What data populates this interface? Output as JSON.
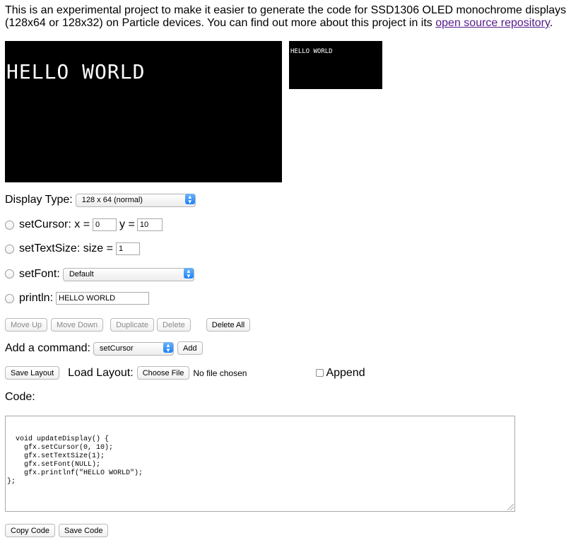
{
  "intro": {
    "text": "This is an experimental project to make it easier to generate the code for SSD1306 OLED monochrome displays (128x64 or 128x32) on Particle devices. You can find out more about this project in its ",
    "link_text": "open source repository",
    "suffix": "."
  },
  "preview": {
    "large_text": "HELLO WORLD",
    "small_text": "HELLO WORLD"
  },
  "display_type": {
    "label": "Display Type:",
    "selected": "128 x 64 (normal)"
  },
  "commands": [
    {
      "name": "setCursor",
      "label": "setCursor: x =",
      "x_value": "0",
      "y_label": "y =",
      "y_value": "10"
    },
    {
      "name": "setTextSize",
      "label": "setTextSize: size =",
      "value": "1"
    },
    {
      "name": "setFont",
      "label": "setFont:",
      "selected": "Default"
    },
    {
      "name": "println",
      "label": "println:",
      "value": "HELLO WORLD"
    }
  ],
  "edit_buttons": {
    "move_up": "Move Up",
    "move_down": "Move Down",
    "duplicate": "Duplicate",
    "delete": "Delete",
    "delete_all": "Delete All"
  },
  "add_command": {
    "label": "Add a command:",
    "selected": "setCursor",
    "button": "Add"
  },
  "layout": {
    "save_button": "Save Layout",
    "load_label": "Load Layout:",
    "choose_file_button": "Choose File",
    "no_file_text": "No file chosen",
    "append_label": "Append"
  },
  "code": {
    "label": "Code:",
    "content": "void updateDisplay() {\n    gfx.setCursor(0, 10);\n    gfx.setTextSize(1);\n    gfx.setFont(NULL);\n    gfx.printlnf(\"HELLO WORLD\");\n};",
    "copy_button": "Copy Code",
    "save_button": "Save Code"
  },
  "colors": {
    "link": "#551a8b",
    "oled_background": "#000000",
    "oled_pixel": "#ffffff",
    "select_arrow": "#1a82fb"
  }
}
